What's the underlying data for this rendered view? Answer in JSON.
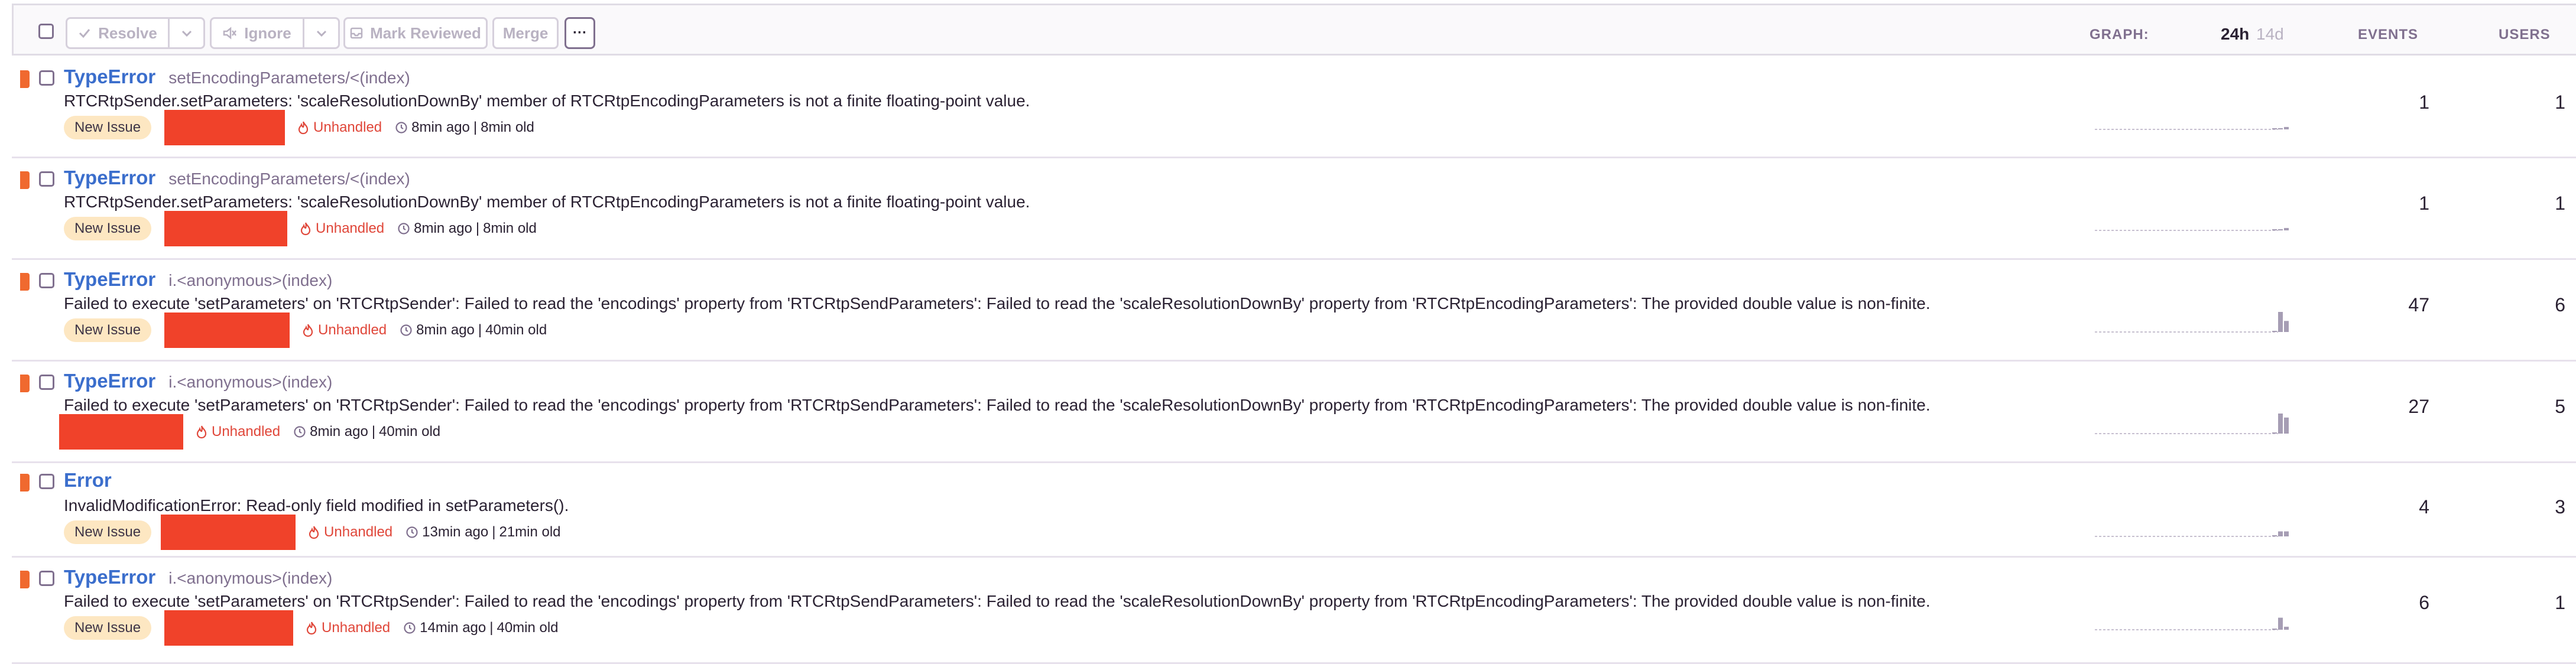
{
  "toolbar": {
    "resolve_label": "Resolve",
    "ignore_label": "Ignore",
    "mark_reviewed_label": "Mark Reviewed",
    "merge_label": "Merge",
    "more_label": "···"
  },
  "header": {
    "graph_label": "GRAPH:",
    "period_24h": "24h",
    "period_14d": "14d",
    "events_label": "EVENTS",
    "users_label": "USERS"
  },
  "colors": {
    "level_error": "#f0692f",
    "type_link": "#3b6ecc",
    "unhandled": "#e0473a",
    "badge_bg": "#fde7c2",
    "redaction": "#f0422a"
  },
  "issues": [
    {
      "type": "TypeError",
      "location": "setEncodingParameters/<(index)",
      "message": "RTCRtpSender.setParameters: 'scaleResolutionDownBy' member of RTCRtpEncodingParameters is not a finite floating-point value.",
      "badge": "New Issue",
      "unhandled": "Unhandled",
      "last_seen": "8min ago",
      "first_seen": "8min old",
      "events": "1",
      "users": "1",
      "spark_last": [
        0,
        0,
        0.12
      ]
    },
    {
      "type": "TypeError",
      "location": "setEncodingParameters/<(index)",
      "message": "RTCRtpSender.setParameters: 'scaleResolutionDownBy' member of RTCRtpEncodingParameters is not a finite floating-point value.",
      "badge": "New Issue",
      "unhandled": "Unhandled",
      "last_seen": "8min ago",
      "first_seen": "8min old",
      "events": "1",
      "users": "1",
      "spark_last": [
        0,
        0,
        0.12
      ]
    },
    {
      "type": "TypeError",
      "location": "i.<anonymous>(index)",
      "message": "Failed to execute 'setParameters' on 'RTCRtpSender': Failed to read the 'encodings' property from 'RTCRtpSendParameters': Failed to read the 'scaleResolutionDownBy' property from 'RTCRtpEncodingParameters': The provided double value is non-finite.",
      "badge": "New Issue",
      "unhandled": "Unhandled",
      "last_seen": "8min ago",
      "first_seen": "40min old",
      "events": "47",
      "users": "6",
      "spark_last": [
        0,
        1.0,
        0.55
      ]
    },
    {
      "type": "TypeError",
      "location": "i.<anonymous>(index)",
      "message": "Failed to execute 'setParameters' on 'RTCRtpSender': Failed to read the 'encodings' property from 'RTCRtpSendParameters': Failed to read the 'scaleResolutionDownBy' property from 'RTCRtpEncodingParameters': The provided double value is non-finite.",
      "badge": "",
      "unhandled": "Unhandled",
      "last_seen": "8min ago",
      "first_seen": "40min old",
      "events": "27",
      "users": "5",
      "spark_last": [
        0,
        1.0,
        0.8
      ]
    },
    {
      "type": "Error",
      "location": "",
      "message": "InvalidModificationError: Read-only field modified in setParameters().",
      "badge": "New Issue",
      "unhandled": "Unhandled",
      "last_seen": "13min ago",
      "first_seen": "21min old",
      "events": "4",
      "users": "3",
      "spark_last": [
        0,
        0.25,
        0.25
      ]
    },
    {
      "type": "TypeError",
      "location": "i.<anonymous>(index)",
      "message": "Failed to execute 'setParameters' on 'RTCRtpSender': Failed to read the 'encodings' property from 'RTCRtpSendParameters': Failed to read the 'scaleResolutionDownBy' property from 'RTCRtpEncodingParameters': The provided double value is non-finite.",
      "badge": "New Issue",
      "unhandled": "Unhandled",
      "last_seen": "14min ago",
      "first_seen": "40min old",
      "events": "6",
      "users": "1",
      "spark_last": [
        0,
        0.6,
        0.15
      ]
    }
  ]
}
